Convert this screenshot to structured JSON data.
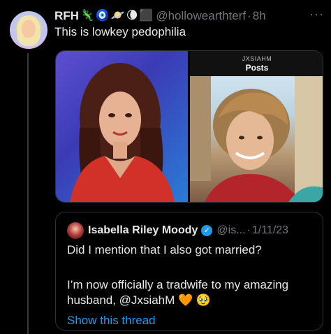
{
  "tweet": {
    "author_name": "RFH",
    "emojis": [
      "🦎",
      "🧿",
      "🪐",
      "🌘",
      "⬛"
    ],
    "handle": "@hollowearthterf",
    "time": "8h",
    "more": "···",
    "text": "This is lowkey pedophilia"
  },
  "media": {
    "right_panel_handle": "JXSIAHM",
    "right_panel_title": "Posts"
  },
  "quote": {
    "author_name": "Isabella Riley Moody",
    "handle": "@is...",
    "date": "1/11/23",
    "line1": "Did I mention that I also got married?",
    "line2": "I’m now officially a tradwife to my amazing",
    "line3": "husband, @JxsiahM 🧡 🥹",
    "show_thread": "Show this thread"
  }
}
